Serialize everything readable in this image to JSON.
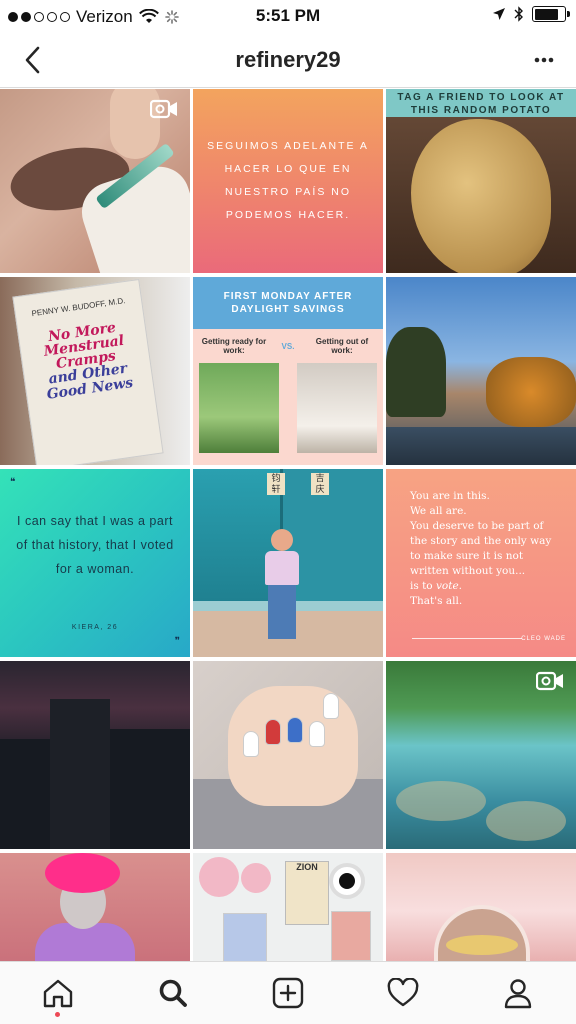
{
  "status_bar": {
    "carrier": "Verizon",
    "time": "5:51 PM",
    "signal_bars_filled": 2,
    "signal_bars_total": 5,
    "battery_level": 0.8
  },
  "header": {
    "title": "refinery29",
    "back_icon": "chevron-left-icon",
    "more_icon": "more-dots-icon"
  },
  "grid": {
    "tile2_text": "SEGUIMOS ADELANTE A HACER LO QUE EN NUESTRO PAÍS NO PODEMOS HACER.",
    "tile3_banner": "TAG A FRIEND TO LOOK AT THIS RANDOM POTATO",
    "tile4_author": "PENNY W. BUDOFF, M.D.",
    "tile4_title_1": "No More Menstrual Cramps",
    "tile4_title_2": "and Other Good News",
    "tile5_header": "FIRST MONDAY AFTER DAYLIGHT SAVINGS",
    "tile5_left": "Getting ready for work:",
    "tile5_vs": "VS.",
    "tile5_right": "Getting out of work:",
    "tile7_open_quote": "❝",
    "tile7_text": "I can say that I was a part of that history, that I voted for a woman.",
    "tile7_sig": "KIERA, 26",
    "tile7_close_quote": "❞",
    "tile8_sign_1": "钧 轩",
    "tile8_sign_2": "吉 庆",
    "tile9_line1": "You are in this.",
    "tile9_line2": "We all are.",
    "tile9_line3": "You deserve to be part of the story and the only way to make sure it is not written without you...",
    "tile9_line4a": "is to ",
    "tile9_line4b": "vote",
    "tile9_line4c": ".",
    "tile9_line5": "That's all.",
    "tile9_sig": "CLEO WADE",
    "tile14_zion": "ZION"
  },
  "tab_bar": {
    "items": [
      {
        "icon": "home-icon",
        "active": true
      },
      {
        "icon": "search-icon",
        "active": false
      },
      {
        "icon": "add-post-icon",
        "active": false
      },
      {
        "icon": "heart-icon",
        "active": false
      },
      {
        "icon": "profile-icon",
        "active": false
      }
    ]
  },
  "colors": {
    "accent_dot": "#ed4956",
    "divider": "#dbdbdb"
  }
}
